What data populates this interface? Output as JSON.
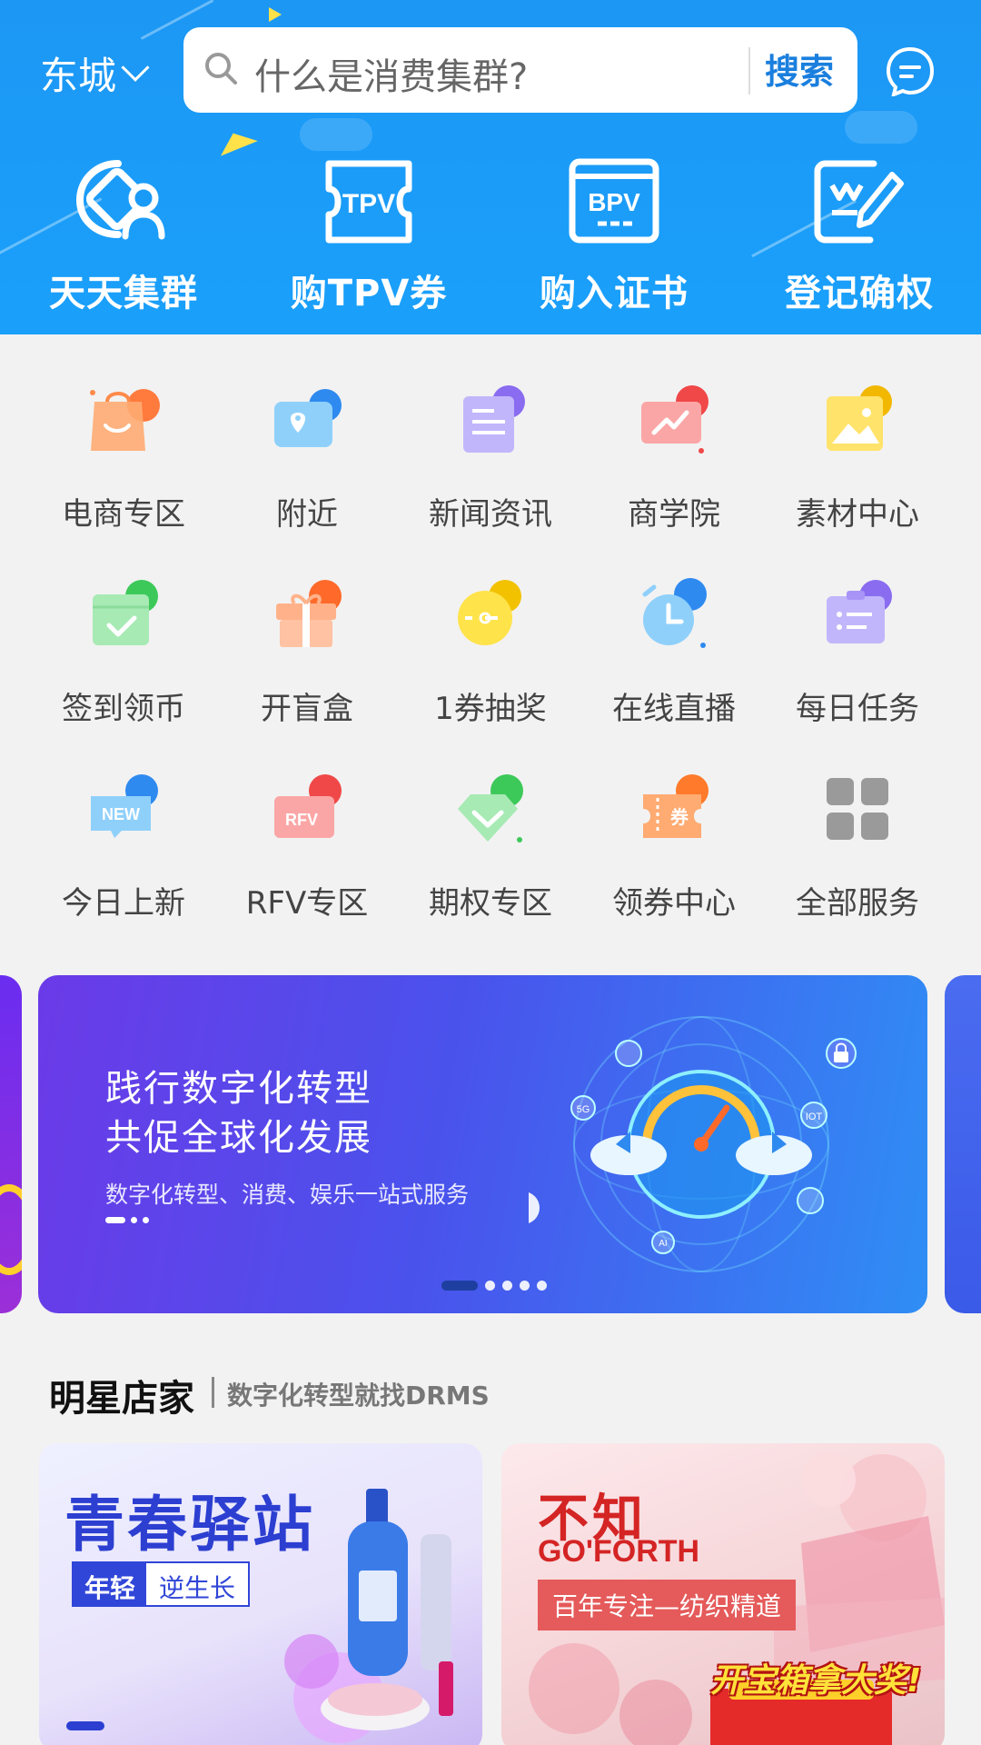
{
  "header": {
    "location": "东城",
    "search_placeholder": "什么是消费集群?",
    "search_button": "搜索",
    "quick_actions": [
      {
        "label": "天天集群",
        "icon": "cluster-user-icon"
      },
      {
        "label": "购TPV券",
        "icon": "tpv-ticket-icon"
      },
      {
        "label": "购入证书",
        "icon": "bpv-certificate-icon"
      },
      {
        "label": "登记确权",
        "icon": "register-edit-icon"
      }
    ]
  },
  "services": [
    {
      "label": "电商专区",
      "icon": "shopping-bag-icon"
    },
    {
      "label": "附近",
      "icon": "map-location-icon"
    },
    {
      "label": "新闻资讯",
      "icon": "news-icon"
    },
    {
      "label": "商学院",
      "icon": "academy-chart-icon"
    },
    {
      "label": "素材中心",
      "icon": "image-material-icon"
    },
    {
      "label": "签到领币",
      "icon": "checkin-calendar-icon"
    },
    {
      "label": "开盲盒",
      "icon": "gift-box-icon"
    },
    {
      "label": "1券抽奖",
      "icon": "lottery-icon"
    },
    {
      "label": "在线直播",
      "icon": "live-clock-icon"
    },
    {
      "label": "每日任务",
      "icon": "daily-task-icon"
    },
    {
      "label": "今日上新",
      "icon": "new-badge-icon"
    },
    {
      "label": "RFV专区",
      "icon": "rfv-ticket-icon"
    },
    {
      "label": "期权专区",
      "icon": "diamond-icon"
    },
    {
      "label": "领券中心",
      "icon": "coupon-icon"
    },
    {
      "label": "全部服务",
      "icon": "all-services-grid-icon"
    }
  ],
  "banner": {
    "line1": "践行数字化转型",
    "line2": "共促全球化发展",
    "line3": "数字化转型、消费、娱乐一站式服务",
    "globe_labels": [
      "5G",
      "IOT",
      "AI"
    ]
  },
  "stars": {
    "title": "明星店家",
    "subtitle": "数字化转型就找DRMS",
    "card_left": {
      "headline": "青春驿站",
      "tag_a": "年轻",
      "tag_b": "逆生长"
    },
    "card_right": {
      "brand_cn": "不知",
      "brand_en": "GO'FORTH",
      "slogan": "百年专注—纺织精道",
      "prize": "开宝箱拿大奖!"
    }
  },
  "colors": {
    "header_blue": "#1c97f4",
    "search_button": "#1a7fde",
    "banner_start": "#6b3ae8",
    "banner_end": "#2f8ef5"
  }
}
